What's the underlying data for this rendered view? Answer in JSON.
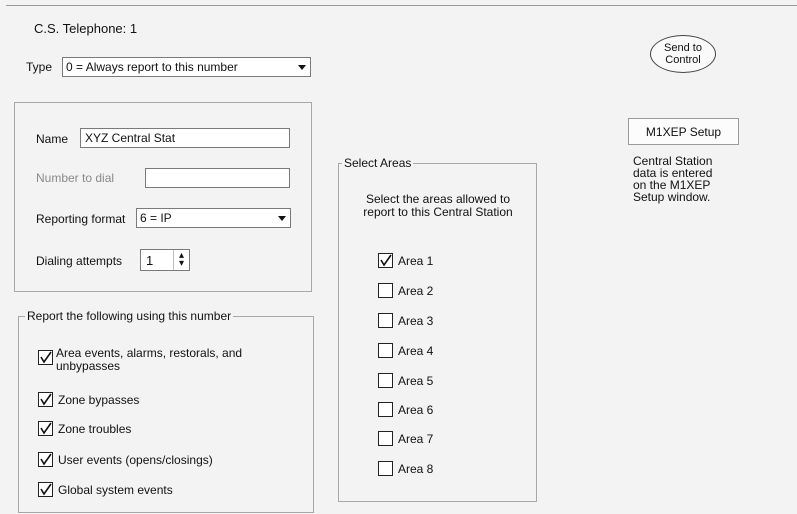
{
  "header": {
    "title": "C.S. Telephone: 1"
  },
  "type_row": {
    "label": "Type",
    "value": "0 = Always report to this number"
  },
  "send_button": {
    "line1": "Send to",
    "line2": "Control"
  },
  "setup": {
    "button_label": "M1XEP Setup",
    "note_lines": [
      "Central Station",
      "data is entered",
      "on the M1XEP",
      "Setup window."
    ]
  },
  "details": {
    "name_label": "Name",
    "name_value": "XYZ Central Stat",
    "number_label": "Number to dial",
    "number_value": "",
    "format_label": "Reporting format",
    "format_value": "6 = IP",
    "attempts_label": "Dialing attempts",
    "attempts_value": "1"
  },
  "report_group": {
    "legend": "Report the following using this number",
    "items": [
      {
        "label_line1": "Area events, alarms, restorals, and",
        "label_line2": "unbypasses",
        "checked": true
      },
      {
        "label": "Zone bypasses",
        "checked": true
      },
      {
        "label": "Zone troubles",
        "checked": true
      },
      {
        "label": "User events (opens/closings)",
        "checked": true
      },
      {
        "label": "Global system events",
        "checked": true
      }
    ]
  },
  "areas_group": {
    "legend": "Select Areas",
    "desc_line1": "Select the areas allowed to",
    "desc_line2": "report to this Central Station",
    "areas": [
      {
        "label": "Area 1",
        "checked": true
      },
      {
        "label": "Area 2",
        "checked": false
      },
      {
        "label": "Area 3",
        "checked": false
      },
      {
        "label": "Area 4",
        "checked": false
      },
      {
        "label": "Area 5",
        "checked": false
      },
      {
        "label": "Area 6",
        "checked": false
      },
      {
        "label": "Area 7",
        "checked": false
      },
      {
        "label": "Area 8",
        "checked": false
      }
    ]
  }
}
